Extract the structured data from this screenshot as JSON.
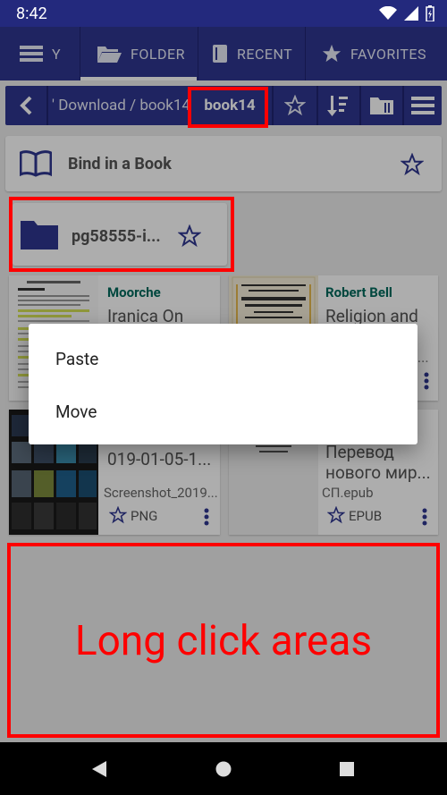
{
  "status": {
    "time": "8:42"
  },
  "tabs": [
    {
      "label": "Y"
    },
    {
      "label": "FOLDER"
    },
    {
      "label": "RECENT"
    },
    {
      "label": "FAVORITES"
    }
  ],
  "path": {
    "prefix": "' Download / book14 /",
    "current": "book14"
  },
  "bind_card": {
    "label": "Bind in a Book"
  },
  "folder_card": {
    "name": "pg58555-i..."
  },
  "books": [
    {
      "author": "Moorche",
      "title": "Iranica On",
      "filename": "",
      "format": ""
    },
    {
      "author": "Robert Bell",
      "title": "Religion and",
      "subtitle": "...s...",
      "filename": "",
      "format": ""
    },
    {
      "author": "",
      "title": "019-01-05-1...",
      "filename": "Screenshot_2019...",
      "format": "PNG"
    },
    {
      "author": "",
      "title": "Перевод нового мир...",
      "filename": "СП.epub",
      "format": "EPUB"
    }
  ],
  "dialog": {
    "items": [
      "Paste",
      "Move"
    ]
  },
  "annotation": {
    "long_click": "Long click areas"
  },
  "colors": {
    "primary": "#2e3590",
    "dark": "#23297d",
    "accent": "#00695c",
    "red": "#ff0000"
  }
}
